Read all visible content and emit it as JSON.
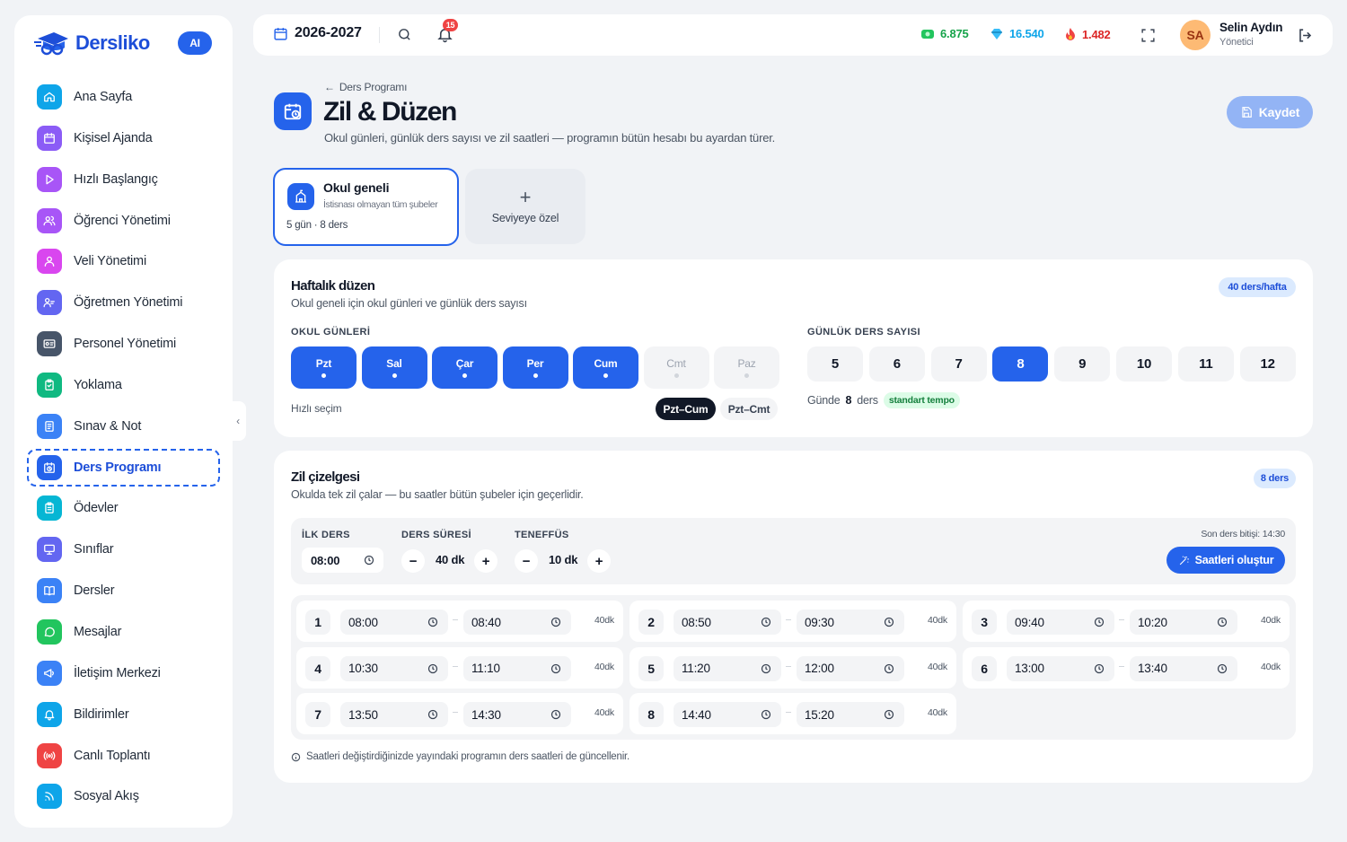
{
  "brand": {
    "name": "Dersliko",
    "ai_badge": "AI"
  },
  "sidebar": {
    "items": [
      {
        "label": "Ana Sayfa",
        "icon": "home-icon",
        "color": "#0ea5e9"
      },
      {
        "label": "Kişisel Ajanda",
        "icon": "calendar-icon",
        "color": "#8b5cf6"
      },
      {
        "label": "Hızlı Başlangıç",
        "icon": "play-icon",
        "color": "#a855f7"
      },
      {
        "label": "Öğrenci Yönetimi",
        "icon": "users-icon",
        "color": "#a855f7"
      },
      {
        "label": "Veli Yönetimi",
        "icon": "parents-icon",
        "color": "#d946ef"
      },
      {
        "label": "Öğretmen Yönetimi",
        "icon": "teacher-icon",
        "color": "#6366f1"
      },
      {
        "label": "Personel Yönetimi",
        "icon": "id-card-icon",
        "color": "#475569"
      },
      {
        "label": "Yoklama",
        "icon": "clipboard-check-icon",
        "color": "#10b981"
      },
      {
        "label": "Sınav & Not",
        "icon": "exam-icon",
        "color": "#3b82f6"
      },
      {
        "label": "Ders Programı",
        "icon": "calendar-clock-icon",
        "color": "#2563eb",
        "active": true
      },
      {
        "label": "Ödevler",
        "icon": "clipboard-icon",
        "color": "#06b6d4"
      },
      {
        "label": "Sınıflar",
        "icon": "monitor-icon",
        "color": "#6366f1"
      },
      {
        "label": "Dersler",
        "icon": "book-icon",
        "color": "#3b82f6"
      },
      {
        "label": "Mesajlar",
        "icon": "chat-icon",
        "color": "#22c55e"
      },
      {
        "label": "İletişim Merkezi",
        "icon": "megaphone-icon",
        "color": "#3b82f6"
      },
      {
        "label": "Bildirimler",
        "icon": "bell-icon",
        "color": "#0ea5e9"
      },
      {
        "label": "Canlı Toplantı",
        "icon": "broadcast-icon",
        "color": "#ef4444"
      },
      {
        "label": "Sosyal Akış",
        "icon": "rss-icon",
        "color": "#0ea5e9"
      }
    ]
  },
  "topbar": {
    "year": "2026-2027",
    "notifications": "15",
    "stats": [
      {
        "value": "6.875",
        "icon": "money-icon",
        "color": "#16a34a"
      },
      {
        "value": "16.540",
        "icon": "gem-icon",
        "color": "#0ea5e9"
      },
      {
        "value": "1.482",
        "icon": "fire-icon",
        "color": "#dc2626"
      }
    ],
    "user": {
      "initials": "SA",
      "name": "Selin Aydın",
      "role": "Yönetici"
    }
  },
  "page": {
    "breadcrumb": "Ders Programı",
    "title": "Zil & Düzen",
    "subtitle": "Okul günleri, günlük ders sayısı ve zil saatleri — programın bütün hesabı bu ayardan türer.",
    "save_label": "Kaydet"
  },
  "scope": {
    "title": "Okul geneli",
    "desc": "İstisnası olmayan tüm şubeler",
    "meta": "5 gün · 8 ders",
    "add_label": "Seviyeye özel"
  },
  "weekly": {
    "title": "Haftalık düzen",
    "subtitle": "Okul geneli için okul günleri ve günlük ders sayısı",
    "badge": "40 ders/hafta",
    "days_label": "OKUL GÜNLERİ",
    "days": [
      {
        "label": "Pzt",
        "on": true
      },
      {
        "label": "Sal",
        "on": true
      },
      {
        "label": "Çar",
        "on": true
      },
      {
        "label": "Per",
        "on": true
      },
      {
        "label": "Cum",
        "on": true
      },
      {
        "label": "Cmt",
        "on": false
      },
      {
        "label": "Paz",
        "on": false
      }
    ],
    "quick_label": "Hızlı seçim",
    "quick": [
      "Pzt–Cum",
      "Pzt–Cmt"
    ],
    "count_label": "GÜNLÜK DERS SAYISI",
    "counts": [
      "5",
      "6",
      "7",
      "8",
      "9",
      "10",
      "11",
      "12"
    ],
    "selected_count": "8",
    "perday_prefix": "Günde",
    "perday_value": "8",
    "perday_suffix": "ders",
    "tempo": "standart tempo"
  },
  "bell": {
    "title": "Zil çizelgesi",
    "subtitle": "Okulda tek zil çalar — bu saatler bütün şubeler için geçerlidir.",
    "badge": "8 ders",
    "first_label": "İLK DERS",
    "first_value": "08:00",
    "duration_label": "DERS SÜRESİ",
    "duration_value": "40 dk",
    "break_label": "TENEFFÜS",
    "break_value": "10 dk",
    "end_text": "Son ders bitişi: 14:30",
    "generate_label": "Saatleri oluştur",
    "periods": [
      {
        "n": "1",
        "start": "08:00",
        "end": "08:40",
        "dur": "40dk"
      },
      {
        "n": "2",
        "start": "08:50",
        "end": "09:30",
        "dur": "40dk"
      },
      {
        "n": "3",
        "start": "09:40",
        "end": "10:20",
        "dur": "40dk"
      },
      {
        "n": "4",
        "start": "10:30",
        "end": "11:10",
        "dur": "40dk"
      },
      {
        "n": "5",
        "start": "11:20",
        "end": "12:00",
        "dur": "40dk"
      },
      {
        "n": "6",
        "start": "13:00",
        "end": "13:40",
        "dur": "40dk"
      },
      {
        "n": "7",
        "start": "13:50",
        "end": "14:30",
        "dur": "40dk"
      },
      {
        "n": "8",
        "start": "14:40",
        "end": "15:20",
        "dur": "40dk"
      }
    ],
    "note": "Saatleri değiştirdiğinizde yayındaki programın ders saatleri de güncellenir."
  }
}
